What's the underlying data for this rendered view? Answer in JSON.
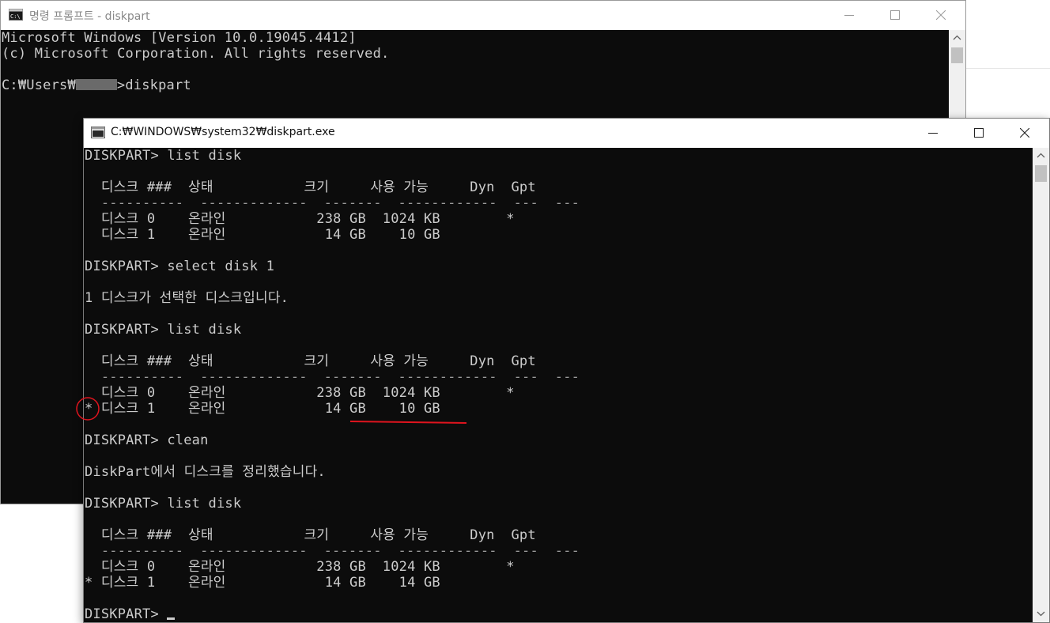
{
  "back_window": {
    "title": "명령 프롬프트 - diskpart",
    "lines": [
      "Microsoft Windows [Version 10.0.19045.4412]",
      "(c) Microsoft Corporation. All rights reserved.",
      "",
      "C:₩Users₩",
      ">diskpart"
    ]
  },
  "front_window": {
    "title": "C:₩WINDOWS₩system32₩diskpart.exe",
    "lines": [
      "DISKPART> list disk",
      "",
      "  디스크 ###  상태           크기     사용 가능     Dyn  Gpt",
      "  ----------  -------------  -------  ------------  ---  ---",
      "  디스크 0    온라인           238 GB  1024 KB        *",
      "  디스크 1    온라인            14 GB    10 GB",
      "",
      "DISKPART> select disk 1",
      "",
      "1 디스크가 선택한 디스크입니다.",
      "",
      "DISKPART> list disk",
      "",
      "  디스크 ###  상태           크기     사용 가능     Dyn  Gpt",
      "  ----------  -------------  -------  ------------  ---  ---",
      "  디스크 0    온라인           238 GB  1024 KB        *",
      "* 디스크 1    온라인            14 GB    10 GB",
      "",
      "DISKPART> clean",
      "",
      "DiskPart에서 디스크를 정리했습니다.",
      "",
      "DISKPART> list disk",
      "",
      "  디스크 ###  상태           크기     사용 가능     Dyn  Gpt",
      "  ----------  -------------  -------  ------------  ---  ---",
      "  디스크 0    온라인           238 GB  1024 KB        *",
      "* 디스크 1    온라인            14 GB    14 GB",
      "",
      "DISKPART> "
    ]
  },
  "window_controls": [
    "minimize-icon",
    "maximize-icon",
    "close-icon"
  ],
  "annotations": {
    "highlight_color": "#e0141e"
  },
  "colors": {
    "console_bg": "#0c0c0c",
    "console_fg": "#cccccc"
  }
}
